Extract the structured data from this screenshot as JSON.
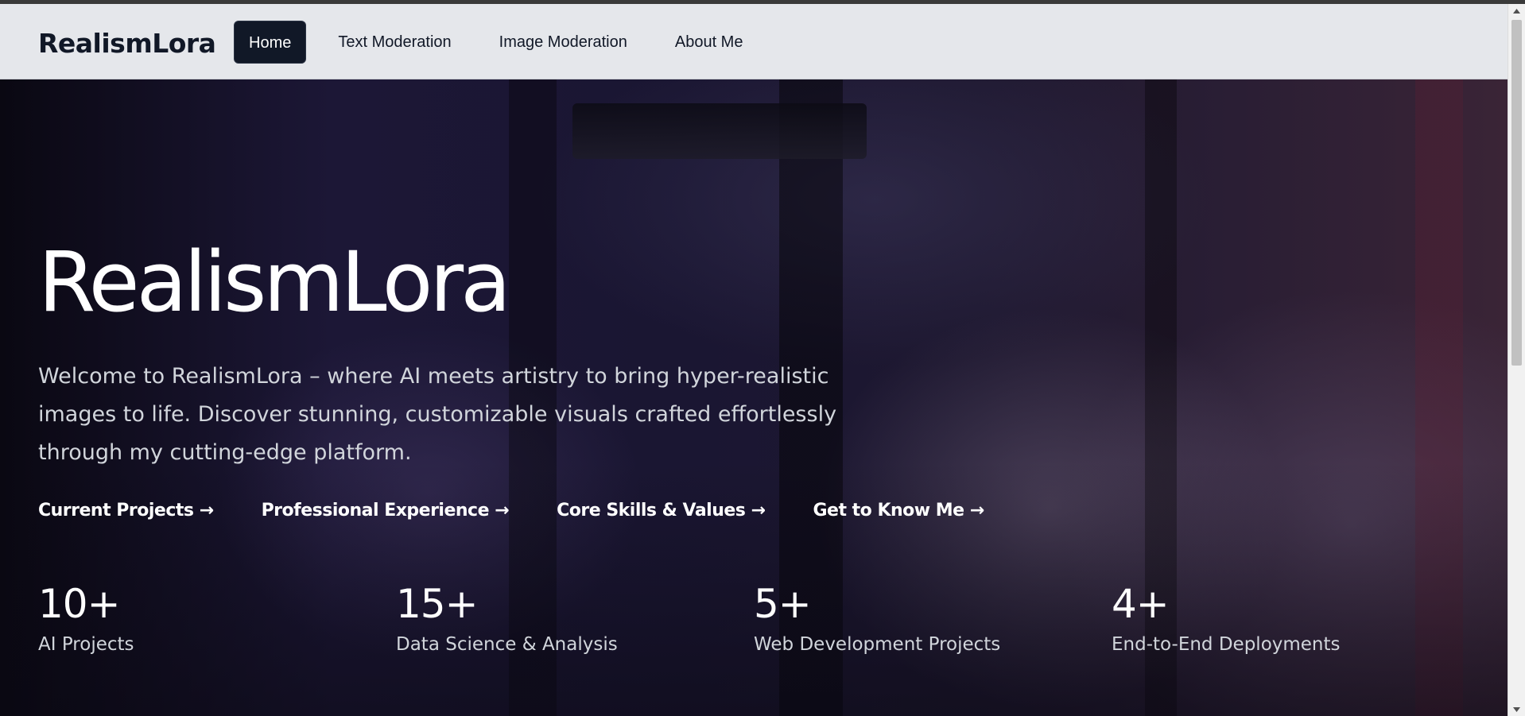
{
  "navbar": {
    "brand": "RealismLora",
    "links": [
      {
        "label": "Home",
        "active": true
      },
      {
        "label": "Text Moderation",
        "active": false
      },
      {
        "label": "Image Moderation",
        "active": false
      },
      {
        "label": "About Me",
        "active": false
      }
    ]
  },
  "hero": {
    "title": "RealismLora",
    "description": "Welcome to RealismLora – where AI meets artistry to bring hyper-realistic images to life. Discover stunning, customizable visuals crafted effortlessly through my cutting-edge platform.",
    "links": [
      {
        "label": "Current Projects →"
      },
      {
        "label": "Professional Experience →"
      },
      {
        "label": "Core Skills & Values →"
      },
      {
        "label": "Get to Know Me →"
      }
    ],
    "stats": [
      {
        "value": "10+",
        "label": "AI Projects"
      },
      {
        "value": "15+",
        "label": "Data Science & Analysis"
      },
      {
        "value": "5+",
        "label": "Web Development Projects"
      },
      {
        "value": "4+",
        "label": "End-to-End Deployments"
      }
    ]
  },
  "scrollbar": {
    "position_fraction": 0.0
  },
  "colors": {
    "navbar_bg": "#e5e7eb",
    "active_tab_bg": "#111827",
    "hero_text": "#ffffff",
    "hero_subtext": "#d1d5db"
  },
  "icons": {
    "scroll_up": "triangle-up-icon",
    "scroll_down": "triangle-down-icon"
  }
}
